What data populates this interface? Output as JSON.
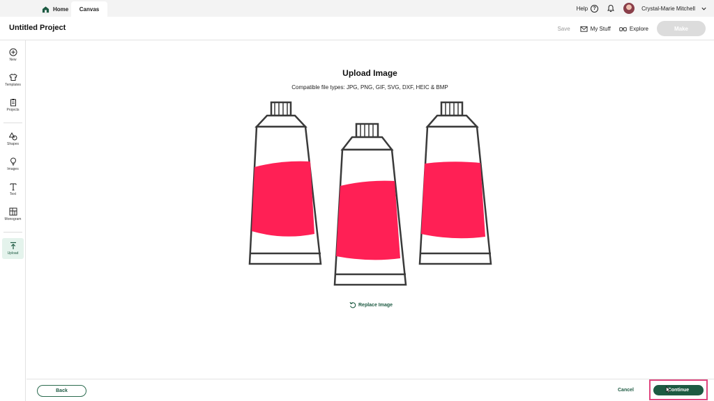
{
  "tabs": [
    {
      "label": "Home",
      "icon": "home-icon"
    },
    {
      "label": "Canvas"
    }
  ],
  "top_right": {
    "help_label": "Help",
    "help_glyph": "?",
    "user_name": "Crystal-Marie Mitchell"
  },
  "header": {
    "project_title": "Untitled Project",
    "save_label": "Save",
    "my_stuff_label": "My Stuff",
    "explore_label": "Explore",
    "make_label": "Make"
  },
  "sidebar": {
    "items": [
      {
        "label": "New",
        "icon": "plus-circle-icon"
      },
      {
        "label": "Templates",
        "icon": "shirt-icon"
      },
      {
        "label": "Projects",
        "icon": "clipboard-icon"
      },
      {
        "label": "Shapes",
        "icon": "shapes-icon"
      },
      {
        "label": "Images",
        "icon": "lightbulb-icon"
      },
      {
        "label": "Text",
        "icon": "text-icon"
      },
      {
        "label": "Monogram",
        "icon": "monogram-icon"
      },
      {
        "label": "Upload",
        "icon": "upload-icon",
        "active": true
      }
    ]
  },
  "main": {
    "title": "Upload Image",
    "file_types": "Compatible file types:  JPG, PNG, GIF, SVG, DXF, HEIC & BMP",
    "replace_label": "Replace Image"
  },
  "footer": {
    "back_label": "Back",
    "cancel_label": "Cancel",
    "continue_label": "Continue"
  },
  "colors": {
    "brand_green": "#1d5a42",
    "tube_fill": "#ff2055",
    "highlight_frame": "#e0457e",
    "make_disabled": "#dcdcdc"
  }
}
